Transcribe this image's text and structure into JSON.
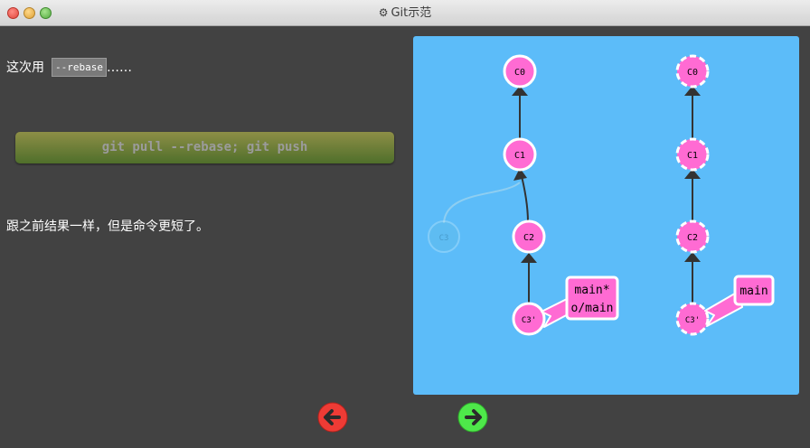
{
  "window": {
    "title": "Git示范",
    "gear_icon": "⚙"
  },
  "instructions": {
    "line1_prefix": "这次用",
    "line1_code": "--rebase",
    "line1_suffix": "……",
    "command": "git pull --rebase; git push",
    "line3": "跟之前结果一样，但是命令更短了。"
  },
  "left_repo": {
    "commits": [
      "C0",
      "C1",
      "C2",
      "C3'"
    ],
    "ghost_commit": "C3",
    "branch_label_1": "main*",
    "branch_label_2": "o/main"
  },
  "right_repo": {
    "commits": [
      "C0",
      "C1",
      "C2",
      "C3'"
    ],
    "branch_label": "main"
  },
  "colors": {
    "commit_fill": "#ff6bd3",
    "viz_background": "#5cbcf9",
    "label_fill": "#ff6bd3",
    "edge": "#333333"
  },
  "nav": {
    "prev_icon": "arrow-left-icon",
    "next_icon": "arrow-right-icon"
  }
}
